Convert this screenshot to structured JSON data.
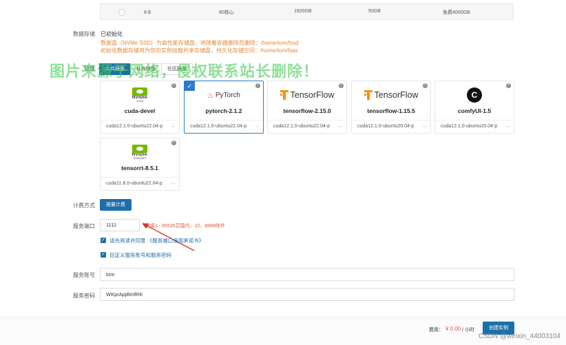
{
  "top_row": {
    "gpu": "8卡",
    "cpu": "80核心",
    "memory": "1920GB",
    "disk": "50GB",
    "data_disk": "免费4000GB"
  },
  "data_storage": {
    "label": "数据存储",
    "status": "已初始化",
    "note1": "数据盘（NVMe SSD）为高性能存储盘，将随着容器删除而删除：/home/tom/fssd",
    "note2": "初始化数据存储将为您的实例挂载共享存储盘，持久化存储空间：/home/tom/fsas"
  },
  "image": {
    "label": "镜像",
    "tabs": [
      "公共镜像",
      "私有镜像",
      "社区镜像"
    ],
    "cards": [
      {
        "name": "cuda-devel",
        "version": "cuda12.1.0-ubuntu22.04-p",
        "logo": "nvidia-logo",
        "logo_sub": "CUDA"
      },
      {
        "name": "pytorch-2.1.2",
        "version": "cuda12.1.0-ubuntu22.04-p",
        "logo": "pytorch-logo",
        "logo_text": "PyTorch",
        "selected": true
      },
      {
        "name": "tensorflow-2.15.0",
        "version": "cuda12.1.0-ubuntu22.04-p",
        "logo": "tensorflow-logo",
        "logo_text": "TensorFlow"
      },
      {
        "name": "tensorflow-1.15.5",
        "version": "cuda12.1.0-ubuntu20.04-p",
        "logo": "tensorflow-logo",
        "logo_text": "TensorFlow"
      },
      {
        "name": "comfyUI-1.5",
        "version": "cuda12.1.0-ubuntu20.04-p",
        "logo": "comfyui-logo"
      },
      {
        "name": "tensorrt-8.5.1",
        "version": "cuda11.8.0-ubuntu22.04-p",
        "logo": "nvidia-logo",
        "logo_sub": "TENSORRT"
      }
    ]
  },
  "billing": {
    "label": "计费方式",
    "button": "按量计费"
  },
  "service_port": {
    "label": "服务端口",
    "value": "1111",
    "hint": "需填1 - 65535范围内，22、8888除外",
    "agree_text": "请先阅读并同意 《服务端口使用承诺书》",
    "custom_text": "自定义服务账号和服务密码"
  },
  "service_account": {
    "label": "服务账号",
    "value": "tom"
  },
  "service_password": {
    "label": "服务密码",
    "value": "WKprApjBmfRK"
  },
  "footer": {
    "fee_label": "费用：",
    "fee_value": "¥ 0.00",
    "fee_unit": "/ 小时",
    "create_button": "创建实例"
  },
  "watermark": "图片来源于网络，侵权联系站长删除！",
  "csdn_credit": "CSDN @weixin_44003104",
  "colors": {
    "primary": "#1d6fa8",
    "accent_orange": "#e0883a",
    "hint_red": "#e05a3a",
    "selected_border": "#2d7bd0"
  }
}
